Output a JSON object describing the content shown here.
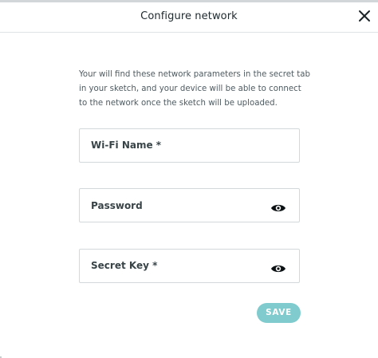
{
  "dialog": {
    "title": "Configure network",
    "close_icon": "close-icon",
    "description": "Your will find these network parameters in the secret tab in your sketch, and your device will be able to connect to the network once the sketch will be uploaded."
  },
  "fields": [
    {
      "label": "Wi-Fi Name *",
      "value": "",
      "icon": null
    },
    {
      "label": "Password",
      "value": "",
      "icon": "eye-icon"
    },
    {
      "label": "Secret Key *",
      "value": "",
      "icon": "eye-icon"
    }
  ],
  "actions": {
    "save_label": "SAVE",
    "save_color": "#7fcbcd"
  }
}
